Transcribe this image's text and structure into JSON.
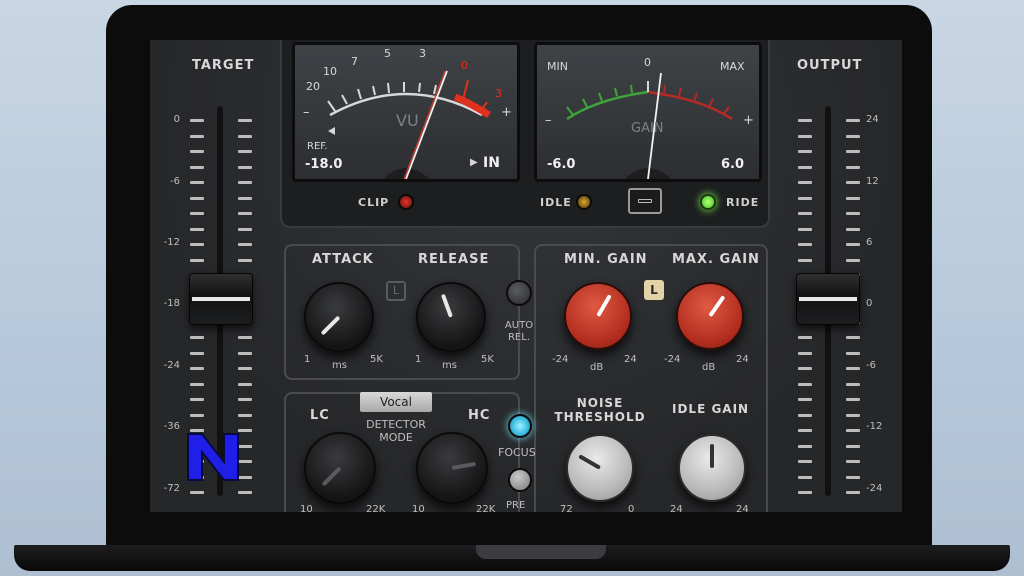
{
  "colors": {
    "accent_red": "#c0392b",
    "led_green": "#7dfc4f",
    "led_cyan": "#6fe3ff",
    "badge_tan": "#e2d2a6",
    "logo_blue": "#1f1fe8"
  },
  "target": {
    "title": "TARGET",
    "ticks": [
      "0",
      "-6",
      "-12",
      "-18",
      "-24",
      "-36",
      "-72"
    ],
    "level_fraction": 0.38
  },
  "output": {
    "title": "OUTPUT",
    "ticks": [
      "24",
      "12",
      "6",
      "0",
      "-6",
      "-12",
      "-24"
    ],
    "level_fraction": 0.5
  },
  "vu_meter": {
    "scale": [
      "20",
      "10",
      "7",
      "5",
      "3",
      "0",
      "3"
    ],
    "minus": "–",
    "plus": "+",
    "name": "VU",
    "ref_label": "REF.",
    "ref_value": "-18.0",
    "input_label": "IN"
  },
  "gain_meter": {
    "min_label": "MIN",
    "zero": "0",
    "max_label": "MAX",
    "minus": "–",
    "plus": "+",
    "name": "GAIN",
    "min_value": "-6.0",
    "max_value": "6.0"
  },
  "status": {
    "clip": "CLIP",
    "idle": "IDLE",
    "ride": "RIDE"
  },
  "dynamics": {
    "attack": "ATTACK",
    "release": "RELEASE",
    "link_badge": "L",
    "attack_min": "1",
    "attack_unit": "ms",
    "attack_max": "5K",
    "release_min": "1",
    "release_unit": "ms",
    "release_max": "5K",
    "auto_rel": "AUTO\nREL."
  },
  "gain_range": {
    "min_gain": "MIN. GAIN",
    "max_gain": "MAX. GAIN",
    "link_badge": "L",
    "min_lo": "-24",
    "min_unit": "dB",
    "min_hi": "24",
    "max_lo": "-24",
    "max_unit": "dB",
    "max_hi": "24"
  },
  "detector": {
    "mode_value": "Vocal",
    "lc": "LC",
    "hc": "HC",
    "mode_label": "DETECTOR\nMODE",
    "focus": "FOCUS",
    "pre": "PRE",
    "lc_min": "10",
    "lc_max": "22K",
    "hc_min": "10",
    "hc_max": "22K"
  },
  "noise": {
    "noise_threshold": "NOISE\nTHRESHOLD",
    "idle_gain": "IDLE GAIN",
    "nt_min": "72",
    "nt_max": "0",
    "ig_min": "24",
    "ig_max": "24"
  },
  "logo": {
    "letter": "N"
  }
}
